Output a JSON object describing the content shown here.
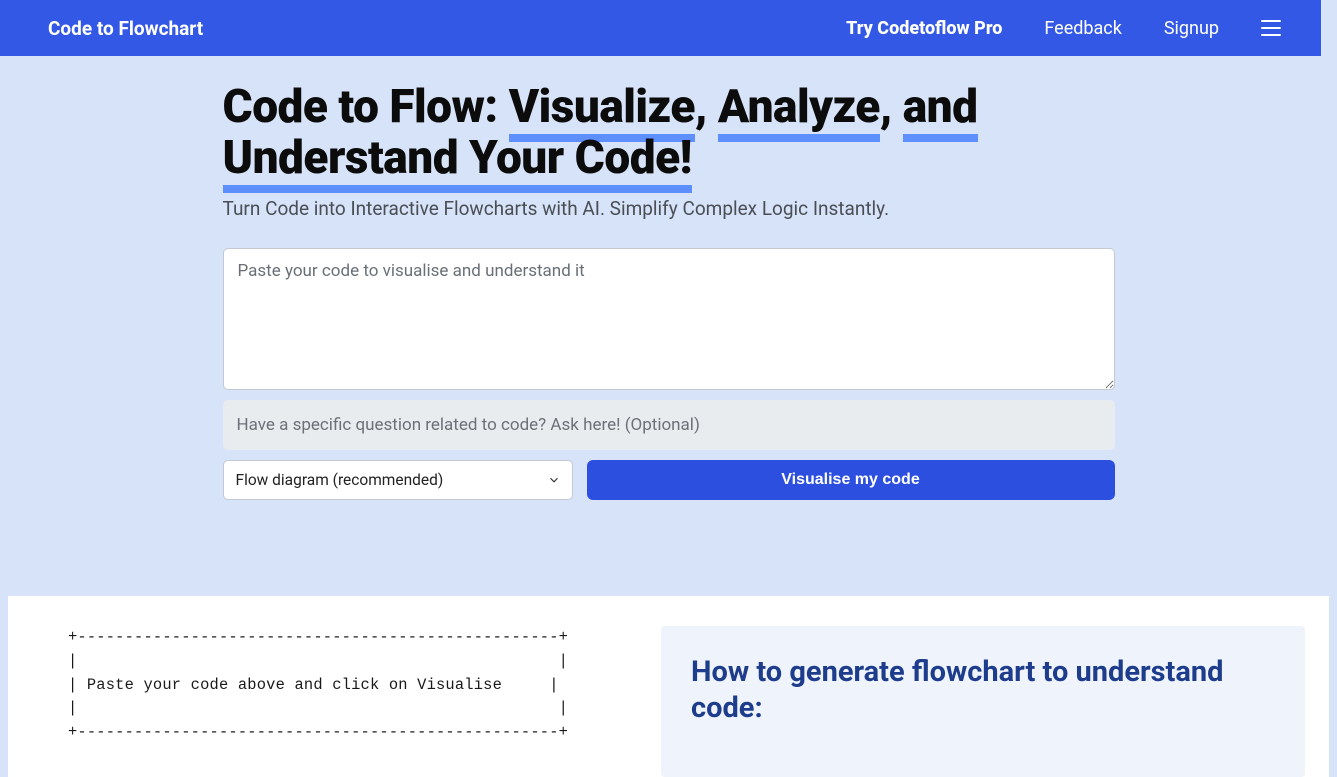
{
  "nav": {
    "brand": "Code to Flowchart",
    "pro": "Try Codetoflow Pro",
    "feedback": "Feedback",
    "signup": "Signup"
  },
  "hero": {
    "plain1": "Code to Flow: ",
    "dec1": "Visualize",
    "plain2": ", ",
    "dec2": "Analyze",
    "plain3": ", ",
    "dec3": "and",
    "plain4": " ",
    "dec4": "Understand Your Code!",
    "sub": "Turn Code into Interactive Flowcharts with AI. Simplify Complex Logic Instantly."
  },
  "form": {
    "code_placeholder": "Paste your code to visualise and understand it",
    "question_placeholder": "Have a specific question related to code? Ask here! (Optional)",
    "select_value": "Flow diagram (recommended)",
    "button": "Visualise my code"
  },
  "ascii": "+---------------------------------------------------+\n|                                                   |\n| Paste your code above and click on Visualise     |\n|                                                   |\n+---------------------------------------------------+",
  "how": {
    "title": "How to generate flowchart to understand code:"
  }
}
